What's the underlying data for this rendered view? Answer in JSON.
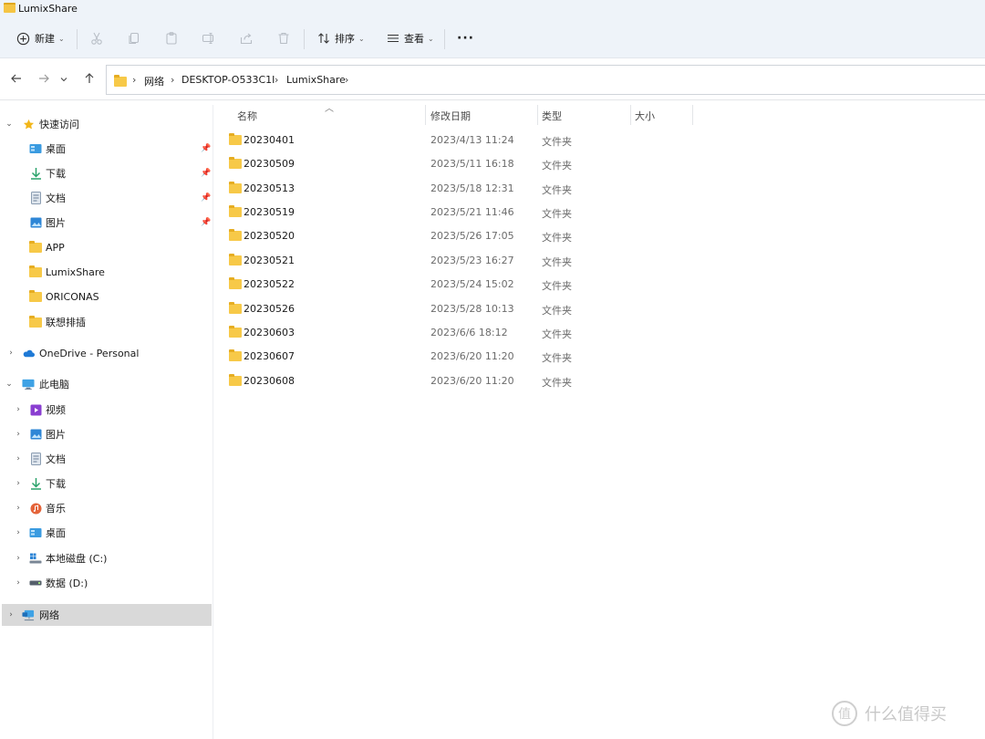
{
  "window": {
    "title": "LumixShare"
  },
  "toolbar": {
    "new_label": "新建",
    "sort_label": "排序",
    "view_label": "查看",
    "more_label": "···"
  },
  "address": {
    "crumbs": [
      "网络",
      "DESKTOP-O533C1I",
      "LumixShare"
    ]
  },
  "sidebar": {
    "quick_access": {
      "label": "快速访问",
      "items": [
        {
          "label": "桌面",
          "icon": "desktop-icon"
        },
        {
          "label": "下载",
          "icon": "download-icon"
        },
        {
          "label": "文档",
          "icon": "document-icon"
        },
        {
          "label": "图片",
          "icon": "pictures-icon"
        },
        {
          "label": "APP",
          "icon": "folder-icon"
        },
        {
          "label": "LumixShare",
          "icon": "folder-icon"
        },
        {
          "label": "ORICONAS",
          "icon": "folder-icon"
        },
        {
          "label": "联想排插",
          "icon": "folder-icon"
        }
      ]
    },
    "onedrive": {
      "label": "OneDrive - Personal"
    },
    "this_pc": {
      "label": "此电脑",
      "items": [
        {
          "label": "视频",
          "icon": "video-icon"
        },
        {
          "label": "图片",
          "icon": "pictures-icon"
        },
        {
          "label": "文档",
          "icon": "document-icon"
        },
        {
          "label": "下载",
          "icon": "download-icon"
        },
        {
          "label": "音乐",
          "icon": "music-icon"
        },
        {
          "label": "桌面",
          "icon": "desktop-icon"
        },
        {
          "label": "本地磁盘 (C:)",
          "icon": "windows-drive-icon"
        },
        {
          "label": "数据 (D:)",
          "icon": "drive-icon"
        }
      ]
    },
    "network": {
      "label": "网络"
    }
  },
  "columns": {
    "name": "名称",
    "modified": "修改日期",
    "type": "类型",
    "size": "大小"
  },
  "files": [
    {
      "name": "20230401",
      "modified": "2023/4/13 11:24",
      "type": "文件夹"
    },
    {
      "name": "20230509",
      "modified": "2023/5/11 16:18",
      "type": "文件夹"
    },
    {
      "name": "20230513",
      "modified": "2023/5/18 12:31",
      "type": "文件夹"
    },
    {
      "name": "20230519",
      "modified": "2023/5/21 11:46",
      "type": "文件夹"
    },
    {
      "name": "20230520",
      "modified": "2023/5/26 17:05",
      "type": "文件夹"
    },
    {
      "name": "20230521",
      "modified": "2023/5/23 16:27",
      "type": "文件夹"
    },
    {
      "name": "20230522",
      "modified": "2023/5/24 15:02",
      "type": "文件夹"
    },
    {
      "name": "20230526",
      "modified": "2023/5/28 10:13",
      "type": "文件夹"
    },
    {
      "name": "20230603",
      "modified": "2023/6/6 18:12",
      "type": "文件夹"
    },
    {
      "name": "20230607",
      "modified": "2023/6/20 11:20",
      "type": "文件夹"
    },
    {
      "name": "20230608",
      "modified": "2023/6/20 11:20",
      "type": "文件夹"
    }
  ],
  "watermark": {
    "text": "什么值得买",
    "glyph": "值"
  }
}
